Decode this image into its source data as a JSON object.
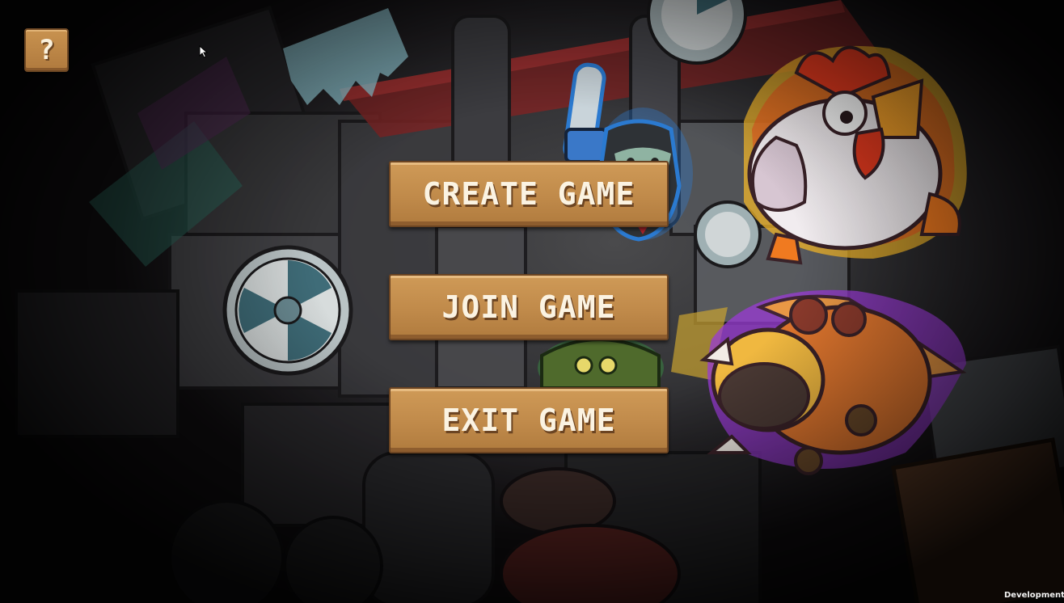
{
  "help_button": {
    "label": "?"
  },
  "menu": {
    "create_label": "CREATE GAME",
    "join_label": "JOIN GAME",
    "exit_label": "EXIT GAME"
  },
  "footer": {
    "build_label": "Development Build"
  },
  "colors": {
    "button_fill": "#c08a4a",
    "button_border": "#6b4422",
    "button_text": "#fbf3e2"
  },
  "icons": [
    "question-mark-icon",
    "mouse-cursor-icon"
  ]
}
